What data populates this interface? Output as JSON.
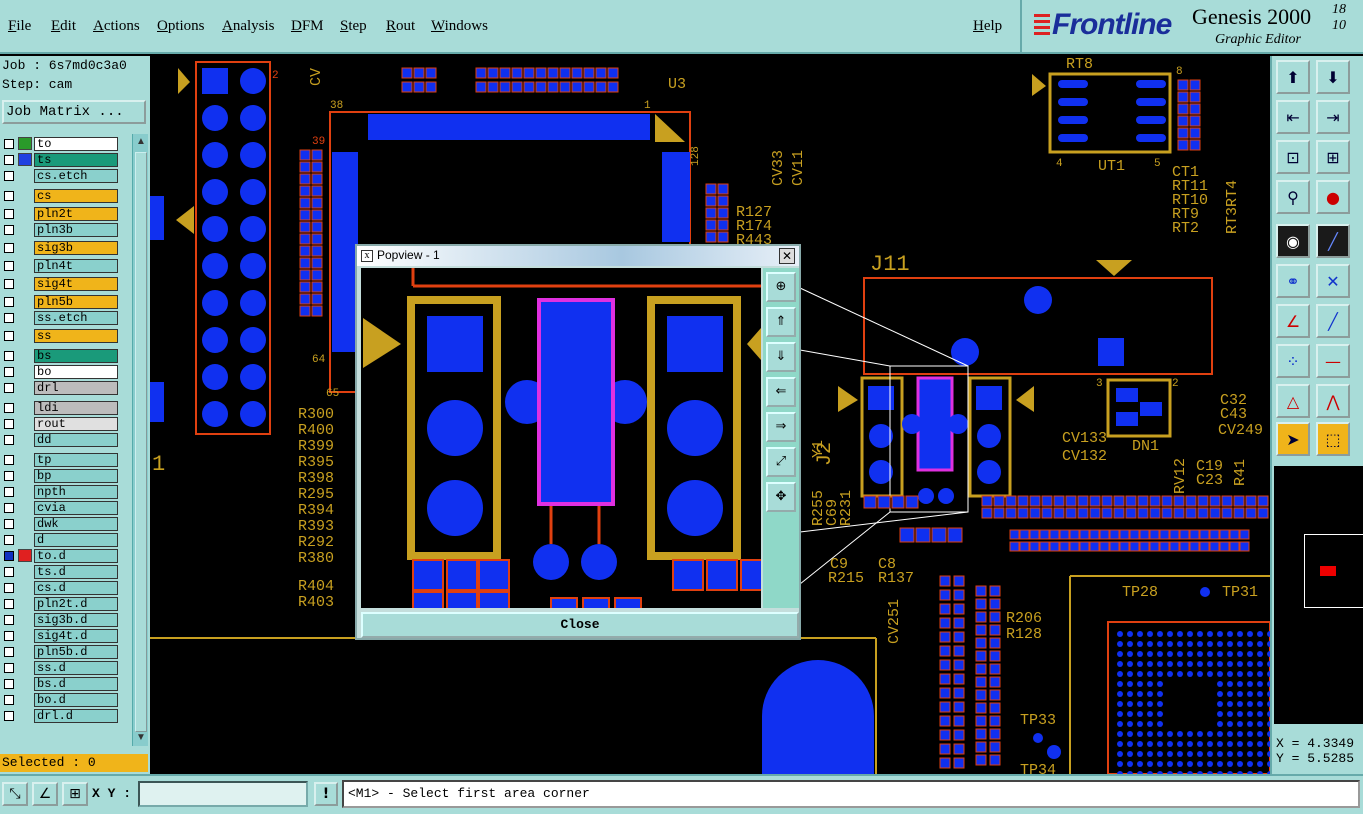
{
  "menu": {
    "file": "File",
    "edit": "Edit",
    "actions": "Actions",
    "options": "Options",
    "analysis": "Analysis",
    "dfm": "DFM",
    "step": "Step",
    "rout": "Rout",
    "windows": "Windows",
    "help": "Help"
  },
  "brand": {
    "logo": "Frontline",
    "title": "Genesis 2000",
    "version_top": "18",
    "version_bottom": "10",
    "subtitle": "Graphic Editor"
  },
  "left": {
    "job": "Job : 6s7md0c3a0",
    "step": "Step: cam",
    "job_matrix": "Job Matrix ...",
    "layers": [
      {
        "name": "to",
        "bg": "#ffffff",
        "swatch": "#2a9a2a"
      },
      {
        "name": "ts",
        "bg": "#1a9a7a",
        "swatch": "#2040e0"
      },
      {
        "name": "cs.etch",
        "bg": "#8ad0cc",
        "swatch": ""
      },
      {
        "name": "cs",
        "bg": "#f0b41a",
        "swatch": ""
      },
      {
        "name": "pln2t",
        "bg": "#f0b41a",
        "swatch": ""
      },
      {
        "name": "pln3b",
        "bg": "#8ad0cc",
        "swatch": ""
      },
      {
        "name": "sig3b",
        "bg": "#f0b41a",
        "swatch": ""
      },
      {
        "name": "pln4t",
        "bg": "#8ad0cc",
        "swatch": ""
      },
      {
        "name": "sig4t",
        "bg": "#f0b41a",
        "swatch": ""
      },
      {
        "name": "pln5b",
        "bg": "#f0b41a",
        "swatch": ""
      },
      {
        "name": "ss.etch",
        "bg": "#8ad0cc",
        "swatch": ""
      },
      {
        "name": "ss",
        "bg": "#f0b41a",
        "swatch": ""
      },
      {
        "name": "bs",
        "bg": "#1a9a7a",
        "swatch": ""
      },
      {
        "name": "bo",
        "bg": "#ffffff",
        "swatch": ""
      },
      {
        "name": "drl",
        "bg": "#bcbcbc",
        "swatch": ""
      },
      {
        "name": "ldi",
        "bg": "#bcbcbc",
        "swatch": ""
      },
      {
        "name": "rout",
        "bg": "#e0e0e0",
        "swatch": ""
      },
      {
        "name": "dd",
        "bg": "#8ad0cc",
        "swatch": ""
      },
      {
        "name": "tp",
        "bg": "#8ad0cc",
        "swatch": ""
      },
      {
        "name": "bp",
        "bg": "#8ad0cc",
        "swatch": ""
      },
      {
        "name": "npth",
        "bg": "#8ad0cc",
        "swatch": ""
      },
      {
        "name": "cvia",
        "bg": "#8ad0cc",
        "swatch": ""
      },
      {
        "name": "dwk",
        "bg": "#8ad0cc",
        "swatch": ""
      },
      {
        "name": "d",
        "bg": "#8ad0cc",
        "swatch": ""
      },
      {
        "name": "to.d",
        "bg": "#8ad0cc",
        "swatch": "#e02020"
      },
      {
        "name": "ts.d",
        "bg": "#8ad0cc",
        "swatch": ""
      },
      {
        "name": "cs.d",
        "bg": "#8ad0cc",
        "swatch": ""
      },
      {
        "name": "pln2t.d",
        "bg": "#8ad0cc",
        "swatch": ""
      },
      {
        "name": "sig3b.d",
        "bg": "#8ad0cc",
        "swatch": ""
      },
      {
        "name": "sig4t.d",
        "bg": "#8ad0cc",
        "swatch": ""
      },
      {
        "name": "pln5b.d",
        "bg": "#8ad0cc",
        "swatch": ""
      },
      {
        "name": "ss.d",
        "bg": "#8ad0cc",
        "swatch": ""
      },
      {
        "name": "bs.d",
        "bg": "#8ad0cc",
        "swatch": ""
      },
      {
        "name": "bo.d",
        "bg": "#8ad0cc",
        "swatch": ""
      },
      {
        "name": "drl.d",
        "bg": "#8ad0cc",
        "swatch": ""
      }
    ],
    "selected": "Selected : 0"
  },
  "canvas": {
    "colors": {
      "pad": "#1030f0",
      "copper": "#c8a020",
      "outline": "#e04010",
      "bg": "#000000"
    },
    "labels": {
      "u3": "U3",
      "rt8": "RT8",
      "ut1": "UT1",
      "j11": "J11",
      "j2": "J2",
      "y1": "Y1",
      "dn1": "DN1",
      "tp28": "TP28",
      "tp31": "TP31",
      "tp33": "TP33",
      "tp34": "TP34",
      "cv33": "CV33",
      "cv11": "CV11",
      "r127": "R127",
      "r174": "R174",
      "r443": "R443",
      "ct1": "CT1",
      "rt11": "RT11",
      "rt10": "RT10",
      "rt9": "RT9",
      "rt2": "RT2",
      "rt3rt4": "RT3RT4",
      "c32": "C32",
      "c43": "C43",
      "cv249": "CV249",
      "cv133": "CV133",
      "cv132": "CV132",
      "c19": "C19",
      "c23": "C23",
      "r41": "R41",
      "rv12": "RV12",
      "r300": "R300",
      "r400": "R400",
      "r399": "R399",
      "r395": "R395",
      "r398": "R398",
      "r295": "R295",
      "r394": "R394",
      "r393": "R393",
      "r292": "R292",
      "r380": "R380",
      "r404": "R404",
      "r403": "R403",
      "r206": "R206",
      "r128": "R128",
      "c9": "C9",
      "c8": "C8",
      "r215": "R215",
      "r137": "R137",
      "cv251": "CV251",
      "pin38": "38",
      "pin39": "39",
      "pin64": "64",
      "pin65": "65",
      "pin128": "128",
      "pin1": "1",
      "pin4": "4",
      "pin5": "5",
      "pin8": "8",
      "pin3": "3",
      "pin2": "2",
      "big1": "1",
      "cv_top": "CV",
      "j2big": "J2",
      "r231": "R231",
      "c69": "C69",
      "r255": "R255"
    }
  },
  "popview": {
    "title": "Popview - 1",
    "close_label": "Close"
  },
  "right": {
    "x": "X = 4.3349",
    "y": "Y = 5.5285"
  },
  "bottom": {
    "xy_label": "X Y :",
    "xy_value": "",
    "message": "<M1> - Select first area corner"
  }
}
